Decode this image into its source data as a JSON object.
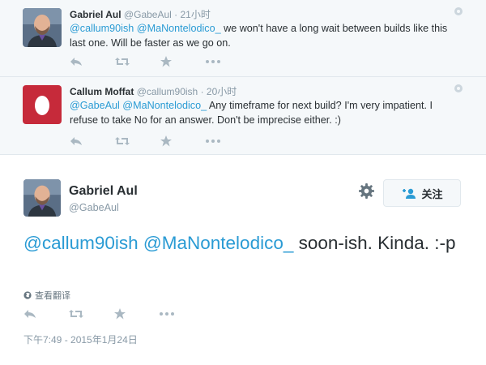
{
  "replies": [
    {
      "name": "Gabriel Aul",
      "handle": "@GabeAul",
      "dot": "·",
      "time": "21小时",
      "mention1": "@callum90ish",
      "mention2": "@MaNontelodico_",
      "text": " we won't have a long wait between builds like this last one. Will be faster as we go on."
    },
    {
      "name": "Callum Moffat",
      "handle": "@callum90ish",
      "dot": "·",
      "time": "20小时",
      "mention1": "@GabeAul",
      "mention2": "@MaNontelodico_",
      "text": "  Any timeframe for next build? I'm very impatient. I refuse to take No for an answer. Don't be imprecise either. :)"
    }
  ],
  "main": {
    "name": "Gabriel Aul",
    "handle": "@GabeAul",
    "follow_label": "关注",
    "mention1": "@callum90ish",
    "mention2": "@MaNontelodico_",
    "text": " soon-ish. Kinda. :-p",
    "translate_label": "查看翻译",
    "timestamp": "下午7:49 - 2015年1月24日"
  },
  "colors": {
    "link": "#2a9bd4",
    "muted": "#8899a6",
    "icon": "#aab8c2",
    "reply_bg": "#f5f8fa"
  },
  "icons": [
    "reply-icon",
    "retweet-icon",
    "favorite-icon",
    "more-icon",
    "gear-icon",
    "follow-person-icon",
    "globe-icon",
    "egg-avatar-icon"
  ]
}
